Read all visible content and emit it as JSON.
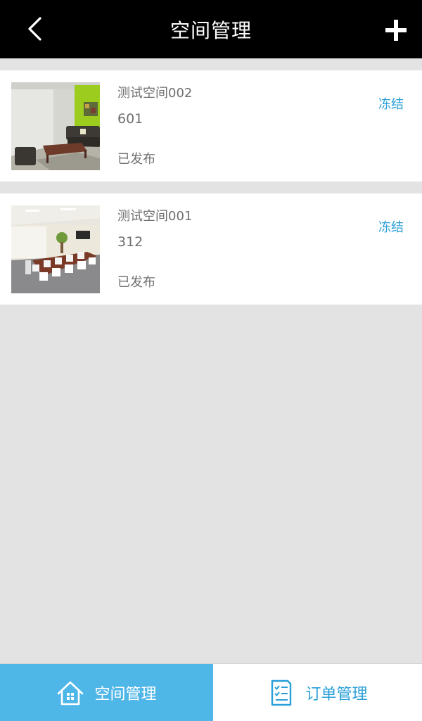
{
  "header": {
    "title": "空间管理",
    "back_icon": "chevron-left-icon",
    "add_icon": "plus-icon"
  },
  "spaces": [
    {
      "name": "测试空间002",
      "number": "601",
      "status": "已发布",
      "action": "冻结",
      "image": "lounge-room-photo"
    },
    {
      "name": "测试空间001",
      "number": "312",
      "status": "已发布",
      "action": "冻结",
      "image": "meeting-room-photo"
    }
  ],
  "tabbar": {
    "tabs": [
      {
        "label": "空间管理",
        "icon": "home-icon",
        "active": true
      },
      {
        "label": "订单管理",
        "icon": "order-list-icon",
        "active": false
      }
    ]
  },
  "colors": {
    "header_bg": "#000000",
    "page_bg": "#e3e3e3",
    "accent": "#2a9fd8",
    "active_tab_bg": "#4fb6e8",
    "text_gray": "#6f6f6f"
  }
}
